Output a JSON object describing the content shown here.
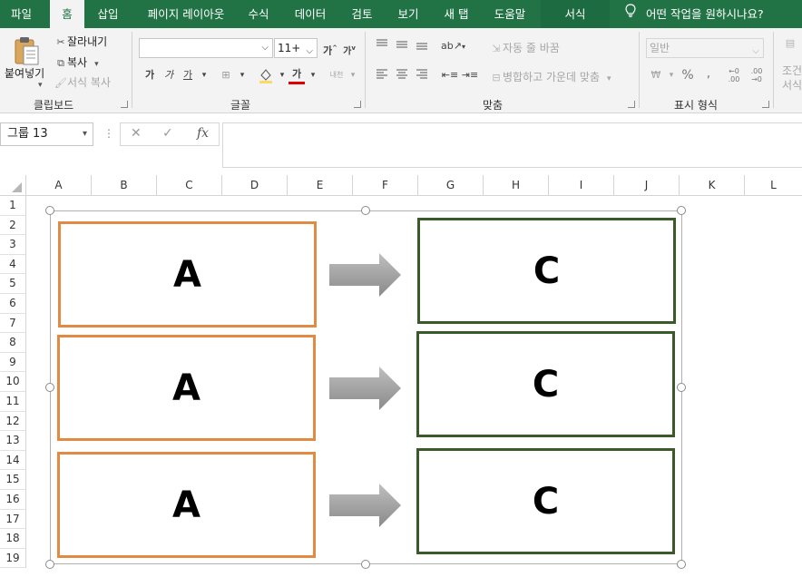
{
  "menu": {
    "tabs": [
      "파일",
      "홈",
      "삽입",
      "페이지 레이아웃",
      "수식",
      "데이터",
      "검토",
      "보기",
      "새 탭",
      "도움말",
      "서식"
    ],
    "active": "홈",
    "tell_me": "어떤 작업을 원하시나요?"
  },
  "ribbon": {
    "clipboard": {
      "paste": "붙여넣기",
      "cut": "잘라내기",
      "copy": "복사",
      "format_painter": "서식 복사",
      "label": "클립보드"
    },
    "font": {
      "font_name": "",
      "font_size": "11+",
      "grow": "가",
      "shrink": "가",
      "bold": "가",
      "italic": "가",
      "underline": "가",
      "font_color_glyph": "가",
      "phonetic": "내천",
      "label": "글꼴"
    },
    "alignment": {
      "wrap_text": "자동 줄 바꿈",
      "merge_center": "병합하고 가운데 맞춤",
      "label": "맞춤"
    },
    "number": {
      "format": "일반",
      "percent": "%",
      "comma": ",",
      "inc_decimal": "←0 .00",
      "dec_decimal": ".00 →0",
      "label": "표시 형식"
    },
    "styles": {
      "conditional_line1": "조건",
      "conditional_line2": "서식"
    }
  },
  "formula_bar": {
    "name_box": "그룹 13",
    "cancel": "✕",
    "enter": "✓",
    "fx": "fx",
    "formula": ""
  },
  "grid": {
    "columns": [
      "A",
      "B",
      "C",
      "D",
      "E",
      "F",
      "G",
      "H",
      "I",
      "J",
      "K",
      "L"
    ],
    "rows": [
      "1",
      "2",
      "3",
      "4",
      "5",
      "6",
      "7",
      "8",
      "9",
      "10",
      "11",
      "12",
      "13",
      "14",
      "15",
      "16",
      "17",
      "18",
      "19"
    ]
  },
  "shapes": {
    "left_boxes": [
      "A",
      "A",
      "A"
    ],
    "right_boxes": [
      "C",
      "C",
      "C"
    ],
    "left_color": "#e08a43",
    "right_color": "#3b5a2a",
    "arrow_color": "#9a9a9a"
  },
  "colors": {
    "menubar": "#217346",
    "ribbon": "#f3f3f3"
  }
}
